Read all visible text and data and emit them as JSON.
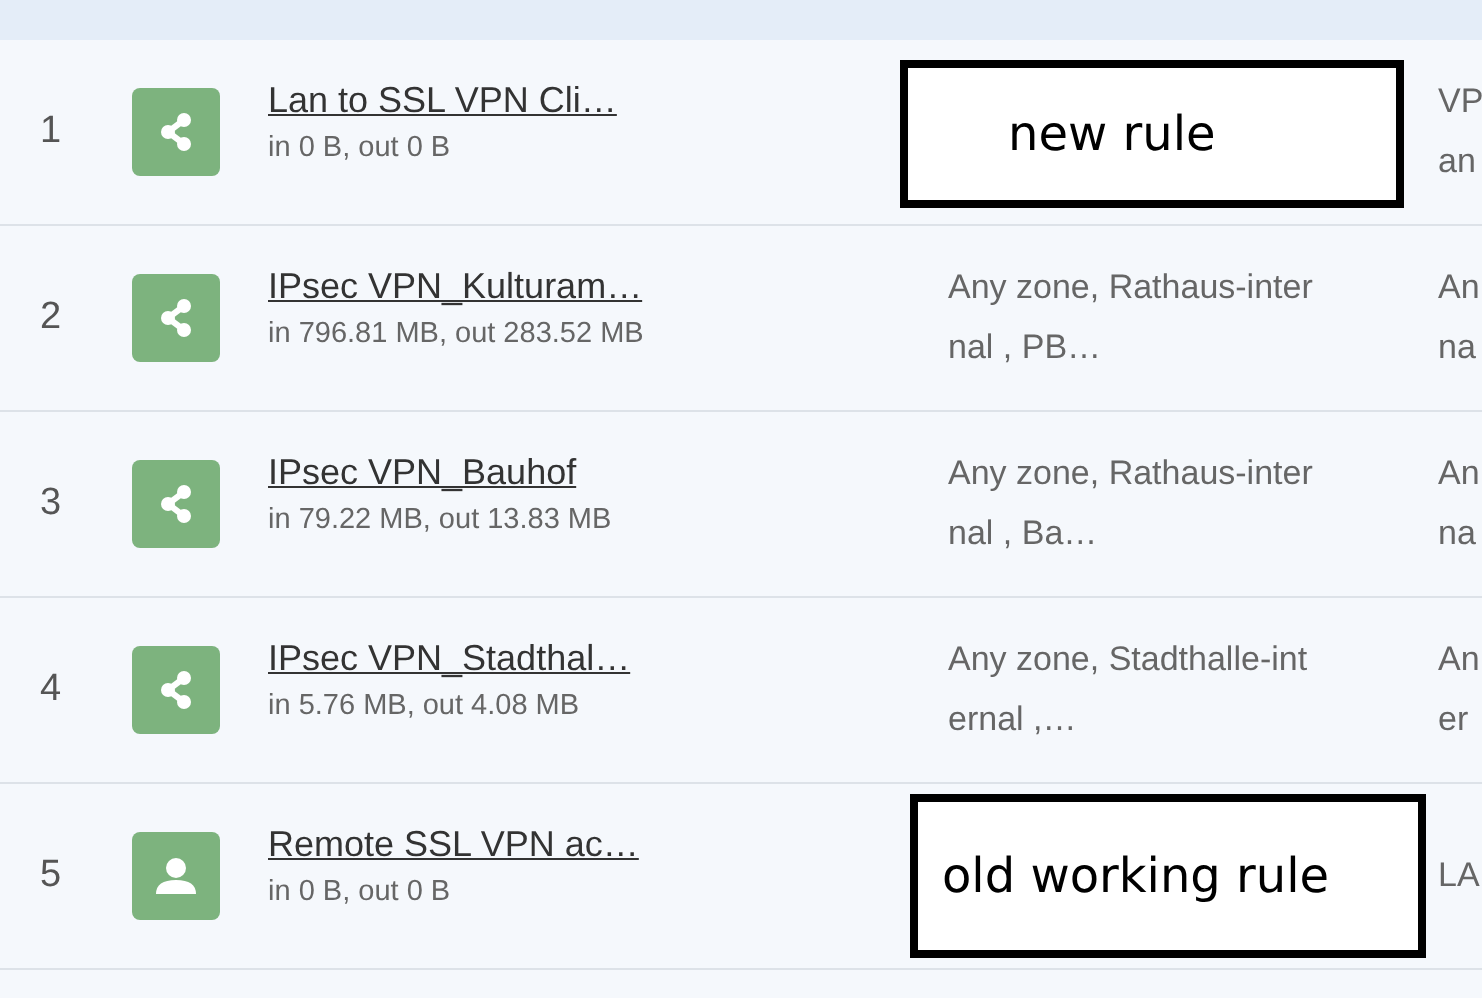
{
  "rules": [
    {
      "number": "1",
      "kind": "network",
      "name": "Lan to SSL VPN Cli…",
      "traffic": "in 0 B, out 0 B",
      "destination": [
        "VP",
        "an"
      ],
      "annotation": "new rule"
    },
    {
      "number": "2",
      "kind": "network",
      "name": "IPsec VPN_Kulturam…",
      "traffic": "in 796.81 MB, out 283.52 MB",
      "source": [
        "Any zone, Rathaus-inter",
        "nal , PB…"
      ],
      "destination": [
        "An",
        "na"
      ]
    },
    {
      "number": "3",
      "kind": "network",
      "name": "IPsec VPN_Bauhof",
      "traffic": "in 79.22 MB, out 13.83 MB",
      "source": [
        "Any zone, Rathaus-inter",
        "nal , Ba…"
      ],
      "destination": [
        "An",
        "na"
      ]
    },
    {
      "number": "4",
      "kind": "network",
      "name": "IPsec VPN_Stadthal…",
      "traffic": "in 5.76 MB, out 4.08 MB",
      "source": [
        "Any zone, Stadthalle-int",
        "ernal ,…"
      ],
      "destination": [
        "An",
        "er"
      ]
    },
    {
      "number": "5",
      "kind": "user",
      "name": "Remote SSL VPN ac…",
      "traffic": "in 0 B, out 0 B",
      "destination": [
        "LA"
      ],
      "annotation": "old working rule"
    }
  ]
}
